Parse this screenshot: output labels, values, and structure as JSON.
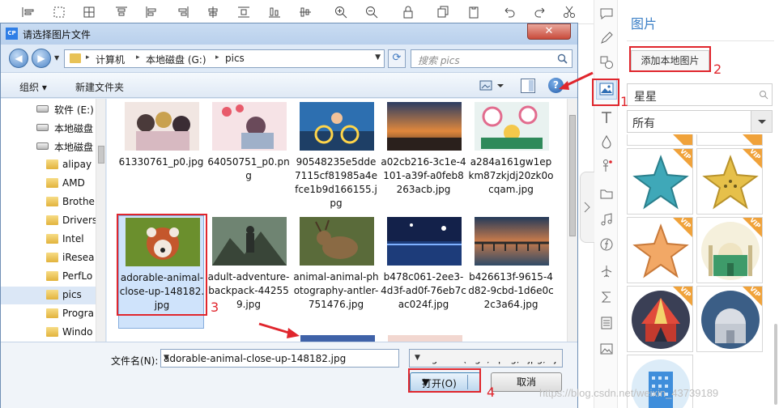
{
  "dialog": {
    "title": "请选择图片文件",
    "breadcrumb": [
      "计算机",
      "本地磁盘 (G:)",
      "pics"
    ],
    "search_placeholder": "搜索 pics",
    "organize": "组织 ▾",
    "new_folder": "新建文件夹",
    "close_label": "✕",
    "nav_items": [
      {
        "label": "软件 (E:)",
        "icon": "drive-icon"
      },
      {
        "label": "本地磁盘",
        "icon": "drive-icon"
      },
      {
        "label": "本地磁盘",
        "icon": "drive-icon"
      },
      {
        "label": "alipay",
        "icon": "folder-icon"
      },
      {
        "label": "AMD",
        "icon": "folder-icon"
      },
      {
        "label": "Brothe",
        "icon": "folder-icon"
      },
      {
        "label": "Drivers",
        "icon": "folder-icon"
      },
      {
        "label": "Intel",
        "icon": "folder-icon"
      },
      {
        "label": "iResea",
        "icon": "folder-icon"
      },
      {
        "label": "PerfLo",
        "icon": "folder-icon"
      },
      {
        "label": "pics",
        "icon": "folder-icon"
      },
      {
        "label": "Progra",
        "icon": "folder-icon"
      },
      {
        "label": "Windo",
        "icon": "folder-icon"
      }
    ],
    "files": [
      {
        "name": "61330761_p0.jpg"
      },
      {
        "name": "64050751_p0.png"
      },
      {
        "name": "90548235e5dde7115cf81985a4efce1b9d166155.jpg"
      },
      {
        "name": "a02cb216-3c1e-4101-a39f-a0feb8263acb.jpg"
      },
      {
        "name": "a284a161gw1epkm87zkjdj20zk0ocqam.jpg"
      },
      {
        "name": "adorable-animal-close-up-148182.jpg"
      },
      {
        "name": "adult-adventure-backpack-442559.jpg"
      },
      {
        "name": "animal-animal-photography-antler-751476.jpg"
      },
      {
        "name": "b478c061-2ee3-4d3f-ad0f-76eb7cac024f.jpg"
      },
      {
        "name": "b426613f-9615-4d82-9cbd-1d6e0c2c3a64.jpg"
      }
    ],
    "filename_label": "文件名(N):",
    "filename_value": "adorable-animal-close-up-148182.jpg",
    "filetype_value": "Image File(*.gif;*.png;*.jpg;*.j",
    "open_label": "打开(O)",
    "cancel_label": "取消"
  },
  "panel": {
    "title": "图片",
    "add_local": "添加本地图片",
    "search_value": "星星",
    "filter_value": "所有",
    "vip_badge": "VIP"
  },
  "annotations": {
    "n1": "1",
    "n2": "2",
    "n3": "3",
    "n4": "4"
  },
  "watermark": "https://blog.csdn.net/weixin_43739189",
  "colors": {
    "accent": "#3b7fc6",
    "annotation": "#e0262d",
    "selection": "#cfe3fb"
  }
}
